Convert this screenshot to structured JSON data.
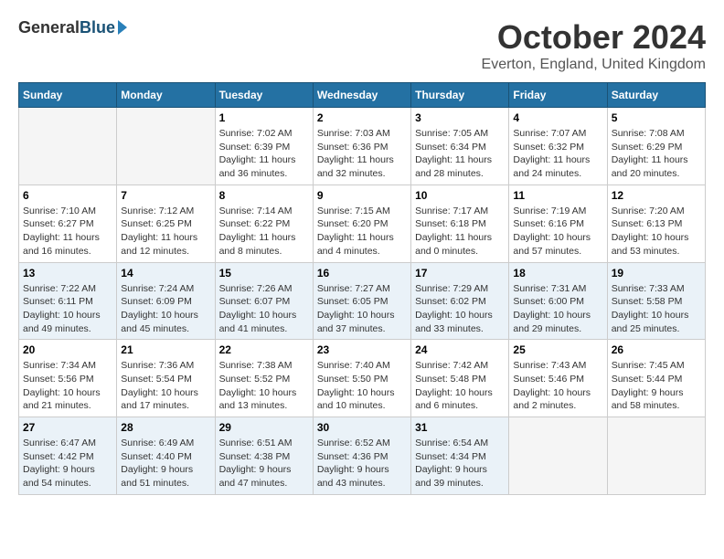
{
  "logo": {
    "general": "General",
    "blue": "Blue"
  },
  "title": "October 2024",
  "location": "Everton, England, United Kingdom",
  "days_of_week": [
    "Sunday",
    "Monday",
    "Tuesday",
    "Wednesday",
    "Thursday",
    "Friday",
    "Saturday"
  ],
  "weeks": [
    [
      {
        "day": "",
        "empty": true
      },
      {
        "day": "",
        "empty": true
      },
      {
        "day": "1",
        "sunrise": "Sunrise: 7:02 AM",
        "sunset": "Sunset: 6:39 PM",
        "daylight": "Daylight: 11 hours and 36 minutes."
      },
      {
        "day": "2",
        "sunrise": "Sunrise: 7:03 AM",
        "sunset": "Sunset: 6:36 PM",
        "daylight": "Daylight: 11 hours and 32 minutes."
      },
      {
        "day": "3",
        "sunrise": "Sunrise: 7:05 AM",
        "sunset": "Sunset: 6:34 PM",
        "daylight": "Daylight: 11 hours and 28 minutes."
      },
      {
        "day": "4",
        "sunrise": "Sunrise: 7:07 AM",
        "sunset": "Sunset: 6:32 PM",
        "daylight": "Daylight: 11 hours and 24 minutes."
      },
      {
        "day": "5",
        "sunrise": "Sunrise: 7:08 AM",
        "sunset": "Sunset: 6:29 PM",
        "daylight": "Daylight: 11 hours and 20 minutes."
      }
    ],
    [
      {
        "day": "6",
        "sunrise": "Sunrise: 7:10 AM",
        "sunset": "Sunset: 6:27 PM",
        "daylight": "Daylight: 11 hours and 16 minutes."
      },
      {
        "day": "7",
        "sunrise": "Sunrise: 7:12 AM",
        "sunset": "Sunset: 6:25 PM",
        "daylight": "Daylight: 11 hours and 12 minutes."
      },
      {
        "day": "8",
        "sunrise": "Sunrise: 7:14 AM",
        "sunset": "Sunset: 6:22 PM",
        "daylight": "Daylight: 11 hours and 8 minutes."
      },
      {
        "day": "9",
        "sunrise": "Sunrise: 7:15 AM",
        "sunset": "Sunset: 6:20 PM",
        "daylight": "Daylight: 11 hours and 4 minutes."
      },
      {
        "day": "10",
        "sunrise": "Sunrise: 7:17 AM",
        "sunset": "Sunset: 6:18 PM",
        "daylight": "Daylight: 11 hours and 0 minutes."
      },
      {
        "day": "11",
        "sunrise": "Sunrise: 7:19 AM",
        "sunset": "Sunset: 6:16 PM",
        "daylight": "Daylight: 10 hours and 57 minutes."
      },
      {
        "day": "12",
        "sunrise": "Sunrise: 7:20 AM",
        "sunset": "Sunset: 6:13 PM",
        "daylight": "Daylight: 10 hours and 53 minutes."
      }
    ],
    [
      {
        "day": "13",
        "sunrise": "Sunrise: 7:22 AM",
        "sunset": "Sunset: 6:11 PM",
        "daylight": "Daylight: 10 hours and 49 minutes."
      },
      {
        "day": "14",
        "sunrise": "Sunrise: 7:24 AM",
        "sunset": "Sunset: 6:09 PM",
        "daylight": "Daylight: 10 hours and 45 minutes."
      },
      {
        "day": "15",
        "sunrise": "Sunrise: 7:26 AM",
        "sunset": "Sunset: 6:07 PM",
        "daylight": "Daylight: 10 hours and 41 minutes."
      },
      {
        "day": "16",
        "sunrise": "Sunrise: 7:27 AM",
        "sunset": "Sunset: 6:05 PM",
        "daylight": "Daylight: 10 hours and 37 minutes."
      },
      {
        "day": "17",
        "sunrise": "Sunrise: 7:29 AM",
        "sunset": "Sunset: 6:02 PM",
        "daylight": "Daylight: 10 hours and 33 minutes."
      },
      {
        "day": "18",
        "sunrise": "Sunrise: 7:31 AM",
        "sunset": "Sunset: 6:00 PM",
        "daylight": "Daylight: 10 hours and 29 minutes."
      },
      {
        "day": "19",
        "sunrise": "Sunrise: 7:33 AM",
        "sunset": "Sunset: 5:58 PM",
        "daylight": "Daylight: 10 hours and 25 minutes."
      }
    ],
    [
      {
        "day": "20",
        "sunrise": "Sunrise: 7:34 AM",
        "sunset": "Sunset: 5:56 PM",
        "daylight": "Daylight: 10 hours and 21 minutes."
      },
      {
        "day": "21",
        "sunrise": "Sunrise: 7:36 AM",
        "sunset": "Sunset: 5:54 PM",
        "daylight": "Daylight: 10 hours and 17 minutes."
      },
      {
        "day": "22",
        "sunrise": "Sunrise: 7:38 AM",
        "sunset": "Sunset: 5:52 PM",
        "daylight": "Daylight: 10 hours and 13 minutes."
      },
      {
        "day": "23",
        "sunrise": "Sunrise: 7:40 AM",
        "sunset": "Sunset: 5:50 PM",
        "daylight": "Daylight: 10 hours and 10 minutes."
      },
      {
        "day": "24",
        "sunrise": "Sunrise: 7:42 AM",
        "sunset": "Sunset: 5:48 PM",
        "daylight": "Daylight: 10 hours and 6 minutes."
      },
      {
        "day": "25",
        "sunrise": "Sunrise: 7:43 AM",
        "sunset": "Sunset: 5:46 PM",
        "daylight": "Daylight: 10 hours and 2 minutes."
      },
      {
        "day": "26",
        "sunrise": "Sunrise: 7:45 AM",
        "sunset": "Sunset: 5:44 PM",
        "daylight": "Daylight: 9 hours and 58 minutes."
      }
    ],
    [
      {
        "day": "27",
        "sunrise": "Sunrise: 6:47 AM",
        "sunset": "Sunset: 4:42 PM",
        "daylight": "Daylight: 9 hours and 54 minutes."
      },
      {
        "day": "28",
        "sunrise": "Sunrise: 6:49 AM",
        "sunset": "Sunset: 4:40 PM",
        "daylight": "Daylight: 9 hours and 51 minutes."
      },
      {
        "day": "29",
        "sunrise": "Sunrise: 6:51 AM",
        "sunset": "Sunset: 4:38 PM",
        "daylight": "Daylight: 9 hours and 47 minutes."
      },
      {
        "day": "30",
        "sunrise": "Sunrise: 6:52 AM",
        "sunset": "Sunset: 4:36 PM",
        "daylight": "Daylight: 9 hours and 43 minutes."
      },
      {
        "day": "31",
        "sunrise": "Sunrise: 6:54 AM",
        "sunset": "Sunset: 4:34 PM",
        "daylight": "Daylight: 9 hours and 39 minutes."
      },
      {
        "day": "",
        "empty": true
      },
      {
        "day": "",
        "empty": true
      }
    ]
  ]
}
